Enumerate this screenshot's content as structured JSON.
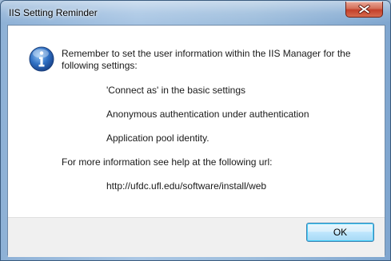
{
  "window": {
    "title": "IIS Setting Reminder"
  },
  "message": {
    "intro_line1": "Remember to set the user information within the IIS Manager for the",
    "intro_line2": "following settings:",
    "settings": [
      "'Connect as' in the basic settings",
      "Anonymous authentication under authentication",
      "Application pool identity."
    ],
    "more_info": "For more information see help at the following url:",
    "url": "http://ufdc.ufl.edu/software/install/web"
  },
  "buttons": {
    "ok_label": "OK"
  },
  "icons": {
    "close": "close-icon",
    "info": "information-icon"
  },
  "colors": {
    "info_icon": "#2a5fb0",
    "close_button": "#c3402a",
    "ok_border": "#3c7fb1"
  }
}
